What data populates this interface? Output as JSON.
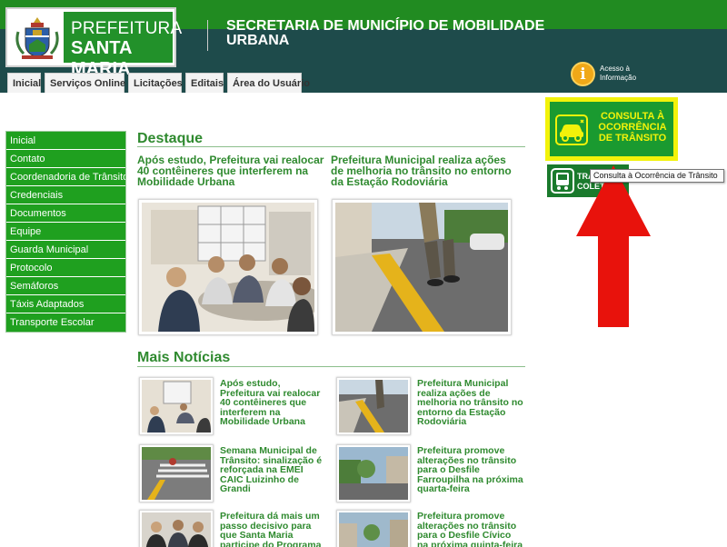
{
  "header": {
    "logo_line1": "PREFEITURA",
    "logo_line2": "SANTA MARIA",
    "title": "SECRETARIA DE MUNICÍPIO DE MOBILIDADE URBANA",
    "tabs": [
      {
        "label": "Inicial"
      },
      {
        "label": "Serviços Online"
      },
      {
        "label": "Licitações"
      },
      {
        "label": "Editais"
      },
      {
        "label": "Área do Usuário"
      }
    ],
    "acesso_label": "Acesso à Informação",
    "acesso_icon": "info-icon"
  },
  "sidebar": {
    "items": [
      {
        "label": "Inicial"
      },
      {
        "label": "Contato"
      },
      {
        "label": "Coordenadoria de Trânsito"
      },
      {
        "label": "Credenciais"
      },
      {
        "label": "Documentos"
      },
      {
        "label": "Equipe"
      },
      {
        "label": "Guarda Municipal"
      },
      {
        "label": "Protocolo"
      },
      {
        "label": "Semáforos"
      },
      {
        "label": "Táxis Adaptados"
      },
      {
        "label": "Transporte Escolar"
      }
    ]
  },
  "destaque": {
    "title": "Destaque",
    "items": [
      {
        "headline": "Após estudo, Prefeitura vai realocar 40 contêineres que interferem na Mobilidade Urbana"
      },
      {
        "headline": "Prefeitura Municipal realiza ações de melhoria no trânsito no entorno da Estação Rodoviária"
      }
    ]
  },
  "mais_noticias": {
    "title": "Mais Notícias",
    "items": [
      {
        "text": "Após estudo, Prefeitura vai realocar 40 contêineres que interferem na Mobilidade Urbana"
      },
      {
        "text": "Prefeitura Municipal realiza ações de melhoria no trânsito no entorno da Estação Rodoviária"
      },
      {
        "text": "Semana Municipal de Trânsito: sinalização é reforçada na EMEI CAIC Luizinho de Grandi"
      },
      {
        "text": "Prefeitura promove alterações no trânsito para o Desfile Farroupilha na próxima quarta-feira"
      },
      {
        "text": "Prefeitura dá mais um passo decisivo para que Santa Maria participe do Programa"
      },
      {
        "text": "Prefeitura promove alterações no trânsito para o Desfile Cívico na próxima quinta-feira"
      }
    ]
  },
  "right": {
    "consulta_label": "CONSULTA À OCORRÊNCIA DE TRÂNSITO",
    "transporte_label": "TRANSPORTE COLETIVO",
    "tooltip": "Consulta à Ocorrência de Trânsito"
  },
  "colors": {
    "header_dark": "#1e4b4b",
    "header_green": "#218b21",
    "sidebar_green": "#1fa01f",
    "title_green": "#2f8a2f",
    "highlight_yellow": "#f2f20a",
    "arrow_red": "#e8120c"
  }
}
